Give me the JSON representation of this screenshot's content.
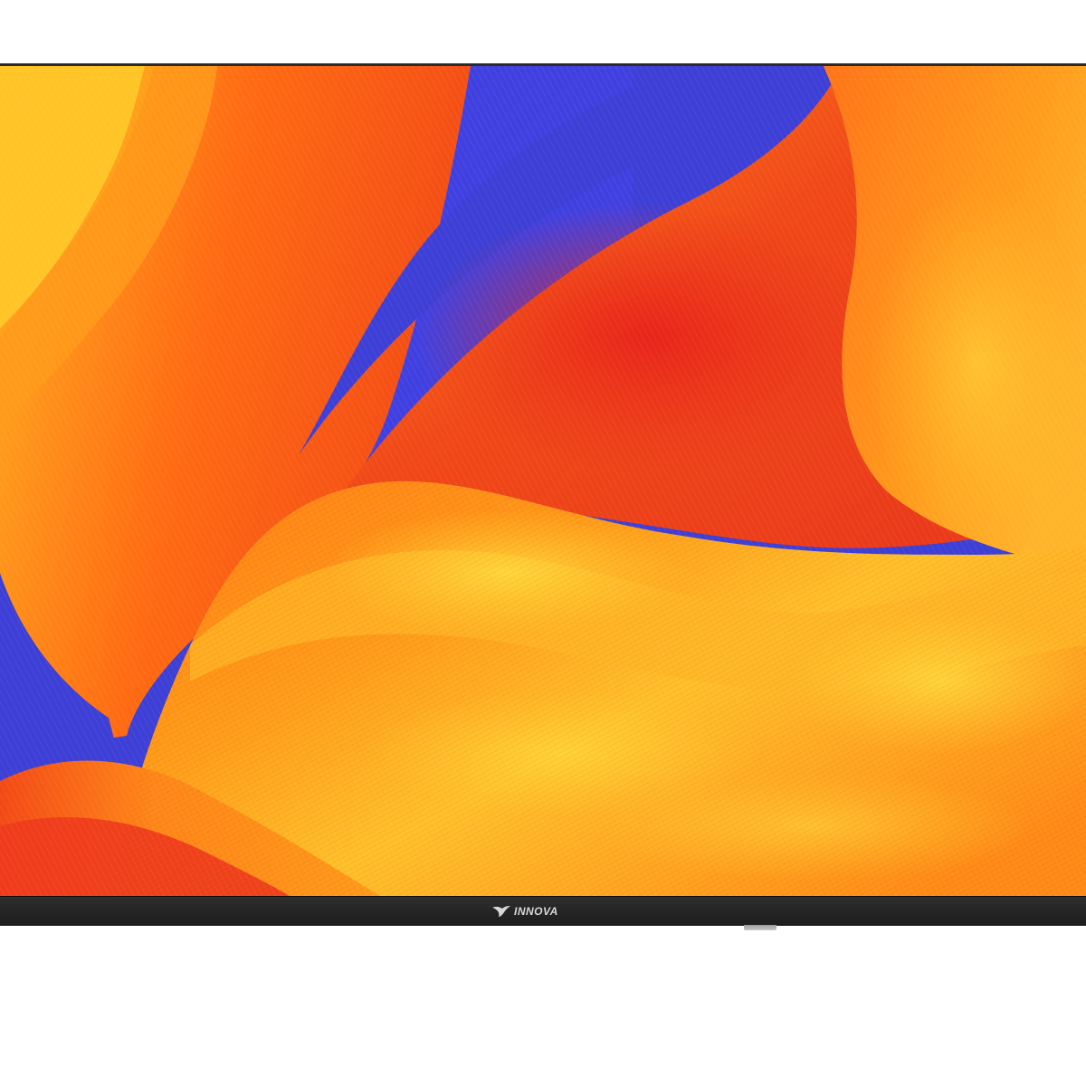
{
  "product": {
    "brand_logo_text": "INNOVA",
    "logo_icon": "bird-swoosh-icon"
  },
  "colors": {
    "background": "#ffffff",
    "bezel": "#1f1f1f",
    "screen_blue": "#3d3fd6",
    "flame_red": "#ee3a1c",
    "flame_orange": "#ff7a14",
    "flame_yellow": "#ffd02a",
    "stand": "#b0b0b0"
  }
}
